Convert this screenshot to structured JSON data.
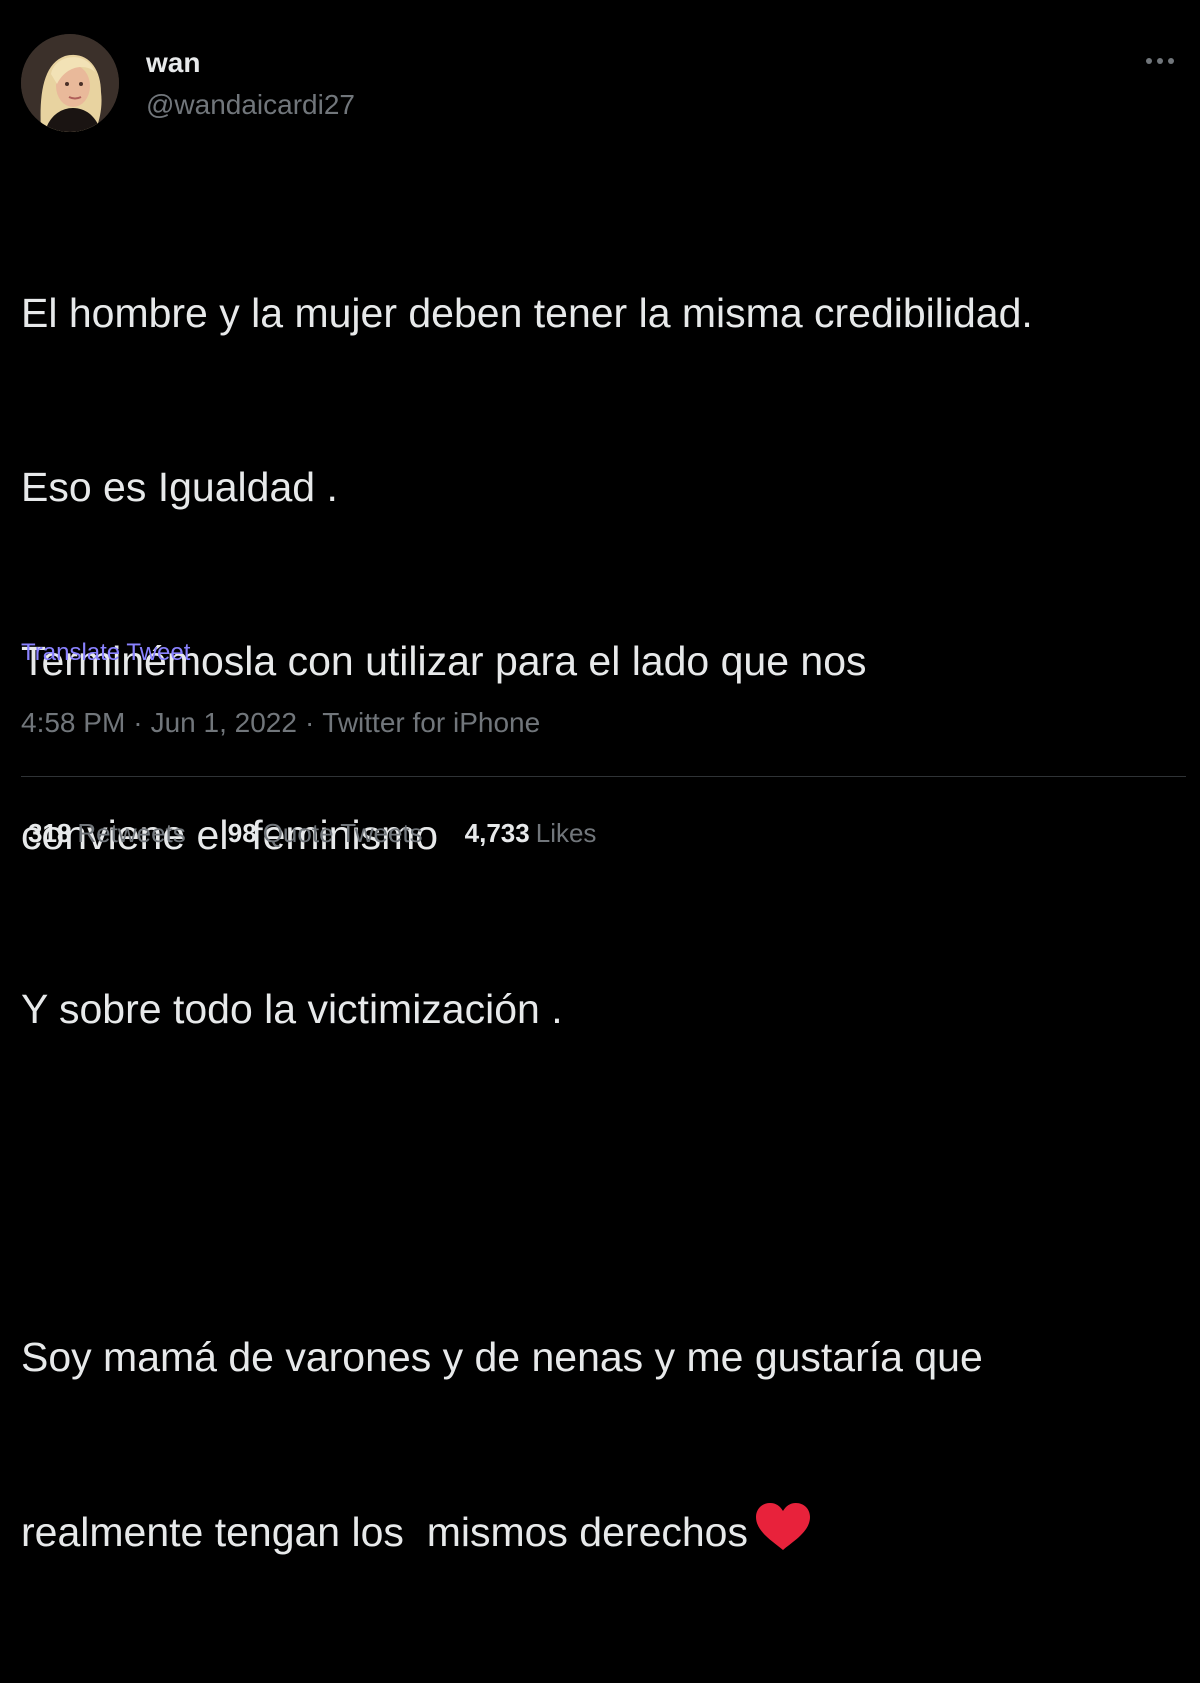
{
  "author": {
    "display_name": "wan",
    "handle": "@wandaicardi27",
    "avatar_icon": "profile-photo"
  },
  "more_icon": "more-horizontal-icon",
  "tweet": {
    "lines": [
      "El hombre y la mujer deben tener la misma credibilidad.",
      "Eso es Igualdad .",
      "Terminémosla con utilizar para el lado que nos",
      "conviene el  feminismo",
      "Y sobre todo la victimización .",
      "",
      "Soy mamá de varones y de nenas y me gustaría que",
      "realmente tengan los  mismos derechos"
    ],
    "emoji": "red-heart-icon"
  },
  "translate_label": "Translate Tweet",
  "meta": {
    "time": "4:58 PM",
    "date": "Jun 1, 2022",
    "source": "Twitter for iPhone",
    "separator": "·"
  },
  "stats": {
    "retweets": {
      "count": "318",
      "label": "Retweets"
    },
    "quote_tweets": {
      "count": "98",
      "label": "Quote Tweets"
    },
    "likes": {
      "count": "4,733",
      "label": "Likes"
    }
  },
  "colors": {
    "background": "#000000",
    "text_primary": "#e7e9ea",
    "text_secondary": "#71767b",
    "link": "#8a82ff",
    "heart": "#e8223b",
    "divider": "#2f3336"
  }
}
